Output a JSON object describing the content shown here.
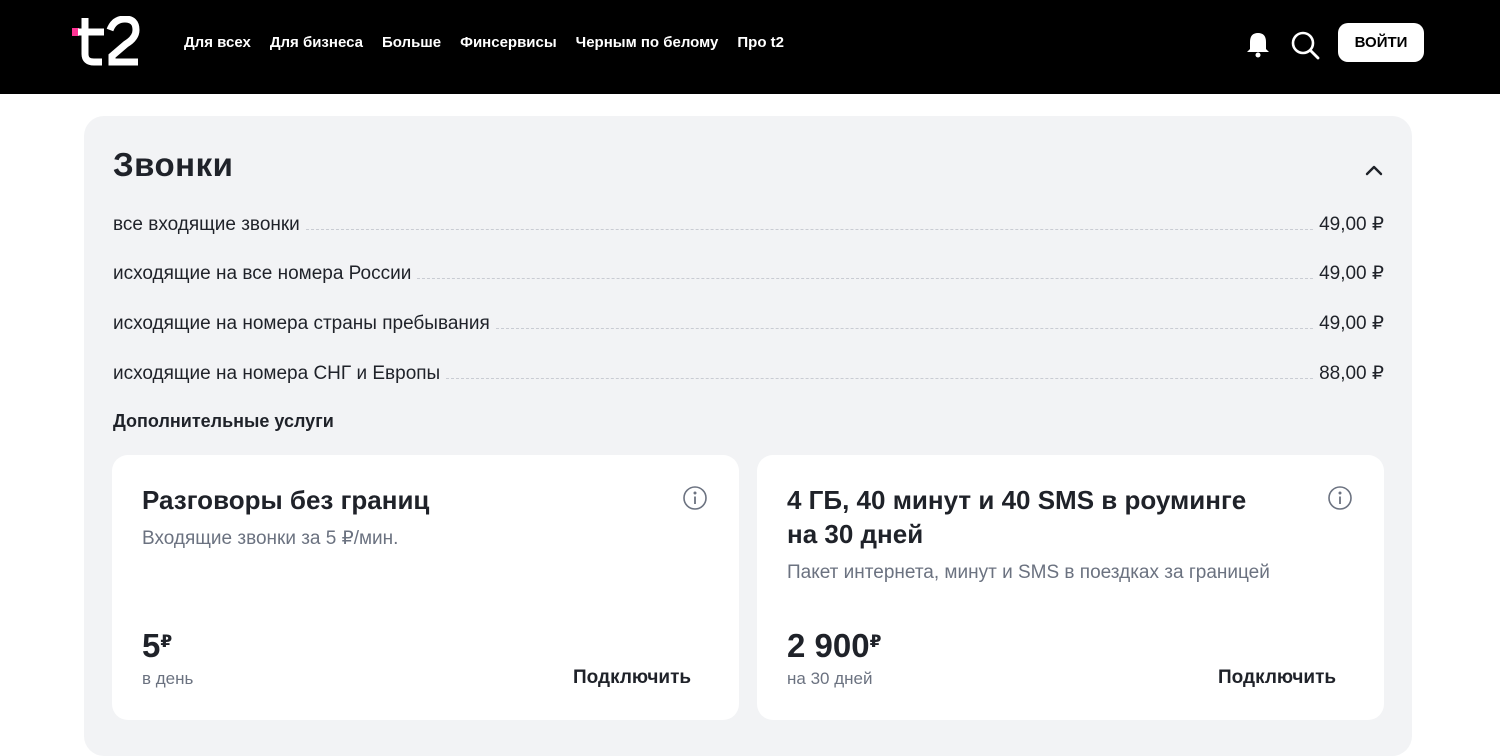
{
  "header": {
    "logo_text": "t2",
    "nav": [
      "Для всех",
      "Для бизнеса",
      "Больше",
      "Финсервисы",
      "Черным по белому",
      "Про t2"
    ],
    "login_label": "ВОЙТИ",
    "icons": [
      "bell-icon",
      "search-icon"
    ],
    "colors": {
      "background": "#000000",
      "accent": "#ff3495"
    }
  },
  "section": {
    "title": "Звонки",
    "rates": [
      {
        "label": "все входящие звонки",
        "price": "49,00 ₽"
      },
      {
        "label": "исходящие на все номера России",
        "price": "49,00 ₽"
      },
      {
        "label": "исходящие на номера страны пребывания",
        "price": "49,00 ₽"
      },
      {
        "label": "исходящие на номера СНГ и Европы",
        "price": "88,00 ₽"
      }
    ],
    "extra_title": "Дополнительные услуги"
  },
  "cards": [
    {
      "title": "Разговоры без границ",
      "description": "Входящие звонки за 5 ₽/мин.",
      "price": "5",
      "currency": "₽",
      "period": "в день",
      "action": "Подключить"
    },
    {
      "title_line1": "4 ГБ, 40 минут и 40 SMS в роуминге",
      "title_line2": "на 30 дней",
      "description": "Пакет интернета, минут и SMS в поездках за границей",
      "price": "2 900",
      "currency": "₽",
      "period": "на 30 дней",
      "action": "Подключить"
    }
  ]
}
